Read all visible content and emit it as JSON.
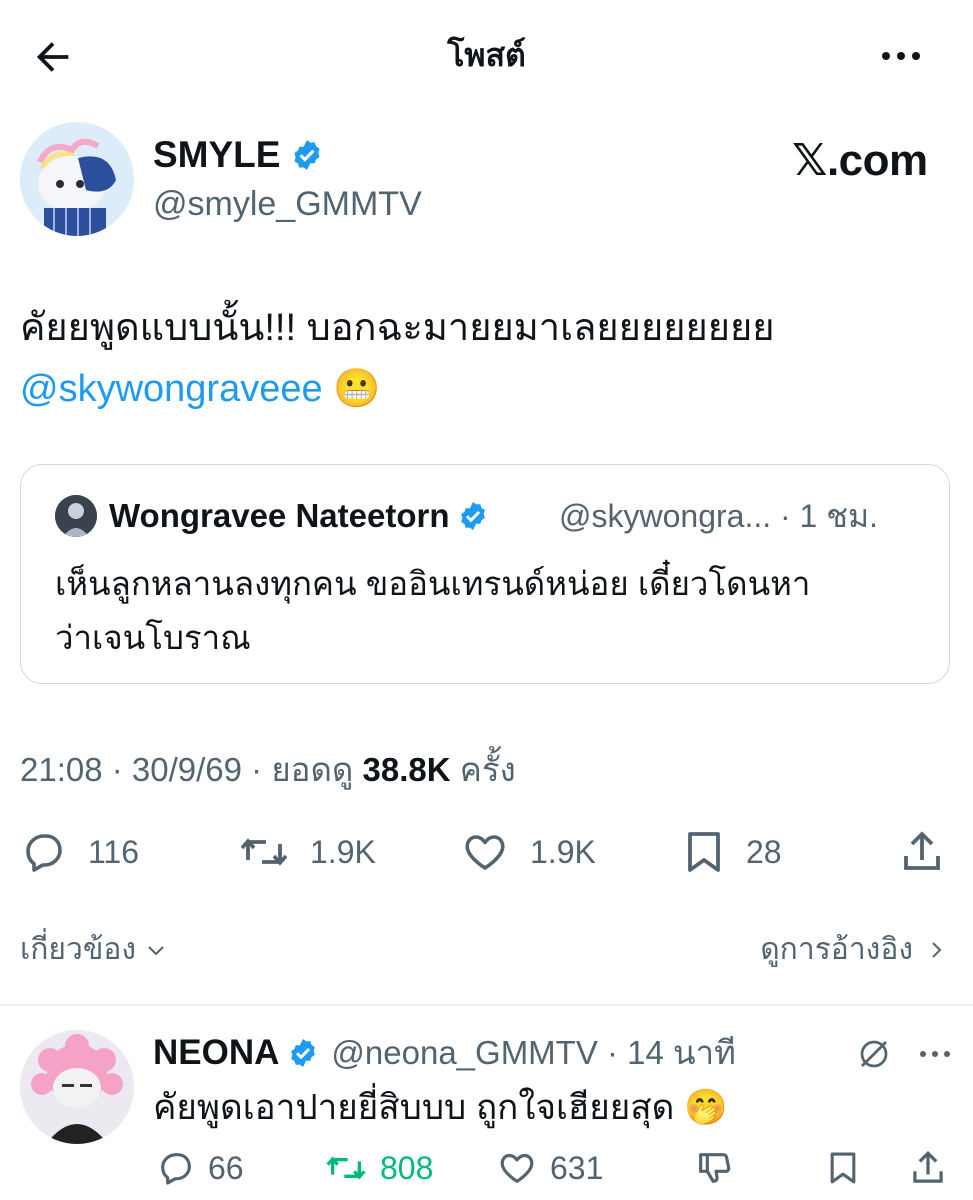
{
  "header": {
    "title": "โพสต์",
    "back_icon": "arrow-left-icon",
    "more_icon": "more-horizontal-icon"
  },
  "author": {
    "name": "SMYLE",
    "handle": "@smyle_GMMTV",
    "verified": true,
    "watermark": "𝕏.com"
  },
  "tweet": {
    "text": "คัยยพูดแบบนั้น!!! บอกฉะมายยมาเลยยยยยยยย",
    "mention": "@skywongraveee",
    "emoji": "😬"
  },
  "quote": {
    "name": "Wongravee Nateetorn",
    "handle": "@skywongra... · 1 ชม.",
    "text_line1": "เห็นลูกหลานลงทุกคน ขออินเทรนด์หน่อย เดี๋ยวโดนหา",
    "text_line2": "ว่าเจนโบราณ"
  },
  "meta": {
    "time_date": "21:08 · 30/9/69 · ยอดดู",
    "views": "38.8K",
    "views_suffix": "ครั้ง"
  },
  "actions": {
    "replies": "116",
    "reposts": "1.9K",
    "likes": "1.9K",
    "bookmarks": "28"
  },
  "related_label": "เกี่ยวข้อง",
  "view_quotes_label": "ดูการอ้างอิง",
  "reply": {
    "name": "NEONA",
    "handle": "@neona_GMMTV · 14 นาที",
    "text": "คัยพูดเอาปายยี่สิบบบ ถูกใจเฮียยสุด",
    "emoji": "🤭",
    "replies": "66",
    "reposts": "808",
    "likes": "631"
  },
  "colors": {
    "accent": "#1d9bf0",
    "repost_active": "#00ba7c",
    "secondary_text": "#536471"
  }
}
